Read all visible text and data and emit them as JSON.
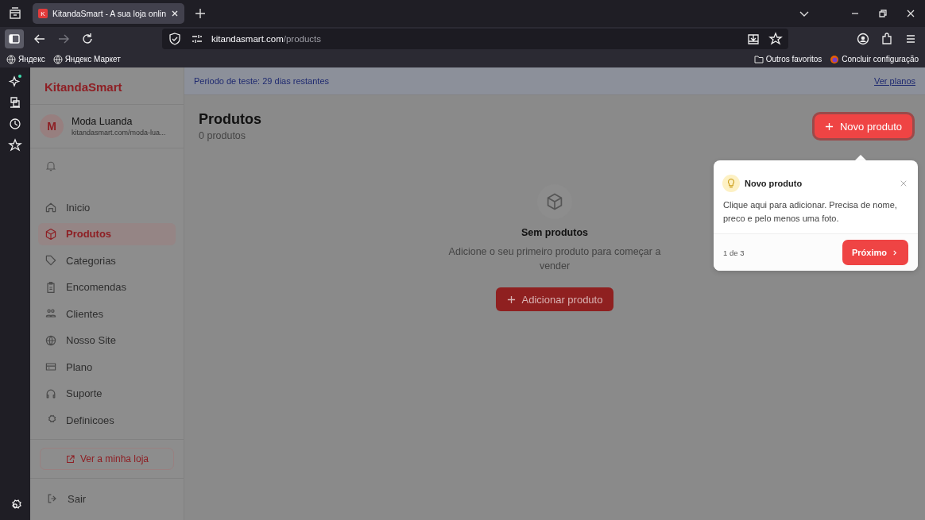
{
  "browser": {
    "tabs": [
      {
        "favicon": "K",
        "title": "KitandaSmart - A sua loja onlin",
        "selected": true
      }
    ],
    "url": {
      "host": "kitandasmart.com",
      "path": "/products"
    },
    "bookmarks_left": [
      "Яндекс",
      "Яндекс Маркет"
    ],
    "bookmarks_right": [
      {
        "kind": "folder",
        "label": "Outros favoritos"
      },
      {
        "kind": "firefox",
        "label": "Concluir configuração"
      }
    ]
  },
  "sidebar": {
    "brand": "KitandaSmart",
    "store": {
      "initial": "M",
      "name": "Moda Luanda",
      "url": "kitandasmart.com/moda-lua..."
    },
    "items": [
      {
        "kind": "home",
        "label": "Inicio",
        "selected": false
      },
      {
        "kind": "box",
        "label": "Produtos",
        "selected": true
      },
      {
        "kind": "tag",
        "label": "Categorias",
        "selected": false
      },
      {
        "kind": "clipboard",
        "label": "Encomendas",
        "selected": false
      },
      {
        "kind": "users",
        "label": "Clientes",
        "selected": false
      },
      {
        "kind": "globe",
        "label": "Nosso Site",
        "selected": false
      },
      {
        "kind": "card",
        "label": "Plano",
        "selected": false
      },
      {
        "kind": "headset",
        "label": "Suporte",
        "selected": false
      },
      {
        "kind": "gear",
        "label": "Definicoes",
        "selected": false
      }
    ],
    "view_store": "Ver a minha loja",
    "logout": "Sair"
  },
  "banner": {
    "text": "Periodo de teste: 29 dias restantes",
    "link": "Ver planos"
  },
  "header": {
    "title": "Produtos",
    "count": "0 produtos",
    "new_button": "Novo produto"
  },
  "empty": {
    "title": "Sem produtos",
    "text": "Adicione o seu primeiro produto para começar a vender",
    "button": "Adicionar produto"
  },
  "tour": {
    "title": "Novo produto",
    "body": "Clique aqui para adicionar. Precisa de nome, preco e pelo menos uma foto.",
    "step": "1 de 3",
    "next": "Próximo"
  }
}
